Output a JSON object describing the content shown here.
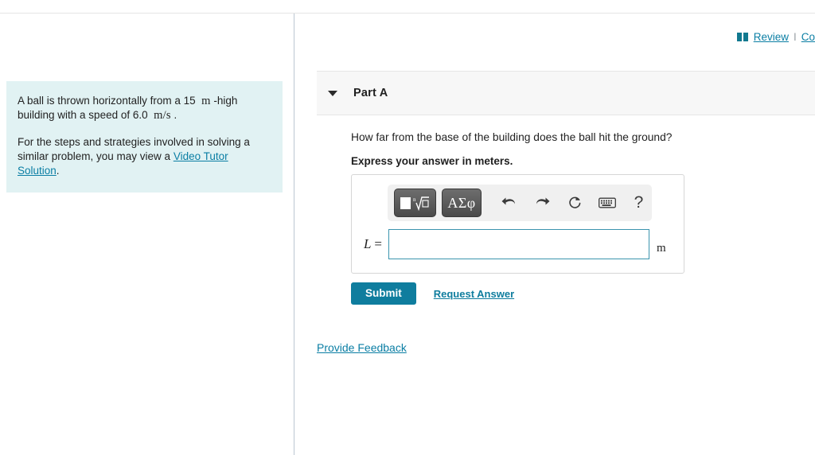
{
  "header": {
    "book_icon": "book-icon",
    "review_label": "Review",
    "separator": "I",
    "constants_label": "Co"
  },
  "problem": {
    "line1_a": "A ball is thrown horizontally from a 15",
    "line1_unit": "m",
    "line1_b": "-high building with a speed of 6.0",
    "line2_unit": "m/s",
    "line2_end": ".",
    "para2_a": "For the steps and strategies involved in solving a similar problem, you may view a ",
    "video_link": "Video Tutor Solution",
    "para2_end": "."
  },
  "part": {
    "caret_icon": "caret-down-icon",
    "title": "Part A",
    "question": "How far from the base of the building does the ball hit the ground?",
    "instruction": "Express your answer in meters."
  },
  "math_toolbar": {
    "template_button": "template-icon",
    "greek_button": "ΑΣφ",
    "undo": "undo-icon",
    "redo": "redo-icon",
    "reset": "reset-icon",
    "keyboard": "keyboard-icon",
    "help": "?"
  },
  "answer": {
    "variable": "L",
    "equals": "=",
    "value": "",
    "placeholder": "",
    "unit": "m"
  },
  "actions": {
    "submit_label": "Submit",
    "request_answer_label": "Request Answer",
    "provide_feedback_label": "Provide Feedback"
  },
  "colors": {
    "accent_teal": "#0f7d9e",
    "link_teal": "#0a7ea4",
    "panel_bg": "#e1f2f3",
    "part_header_bg": "#f7f7f7",
    "input_border": "#3b94ae"
  }
}
